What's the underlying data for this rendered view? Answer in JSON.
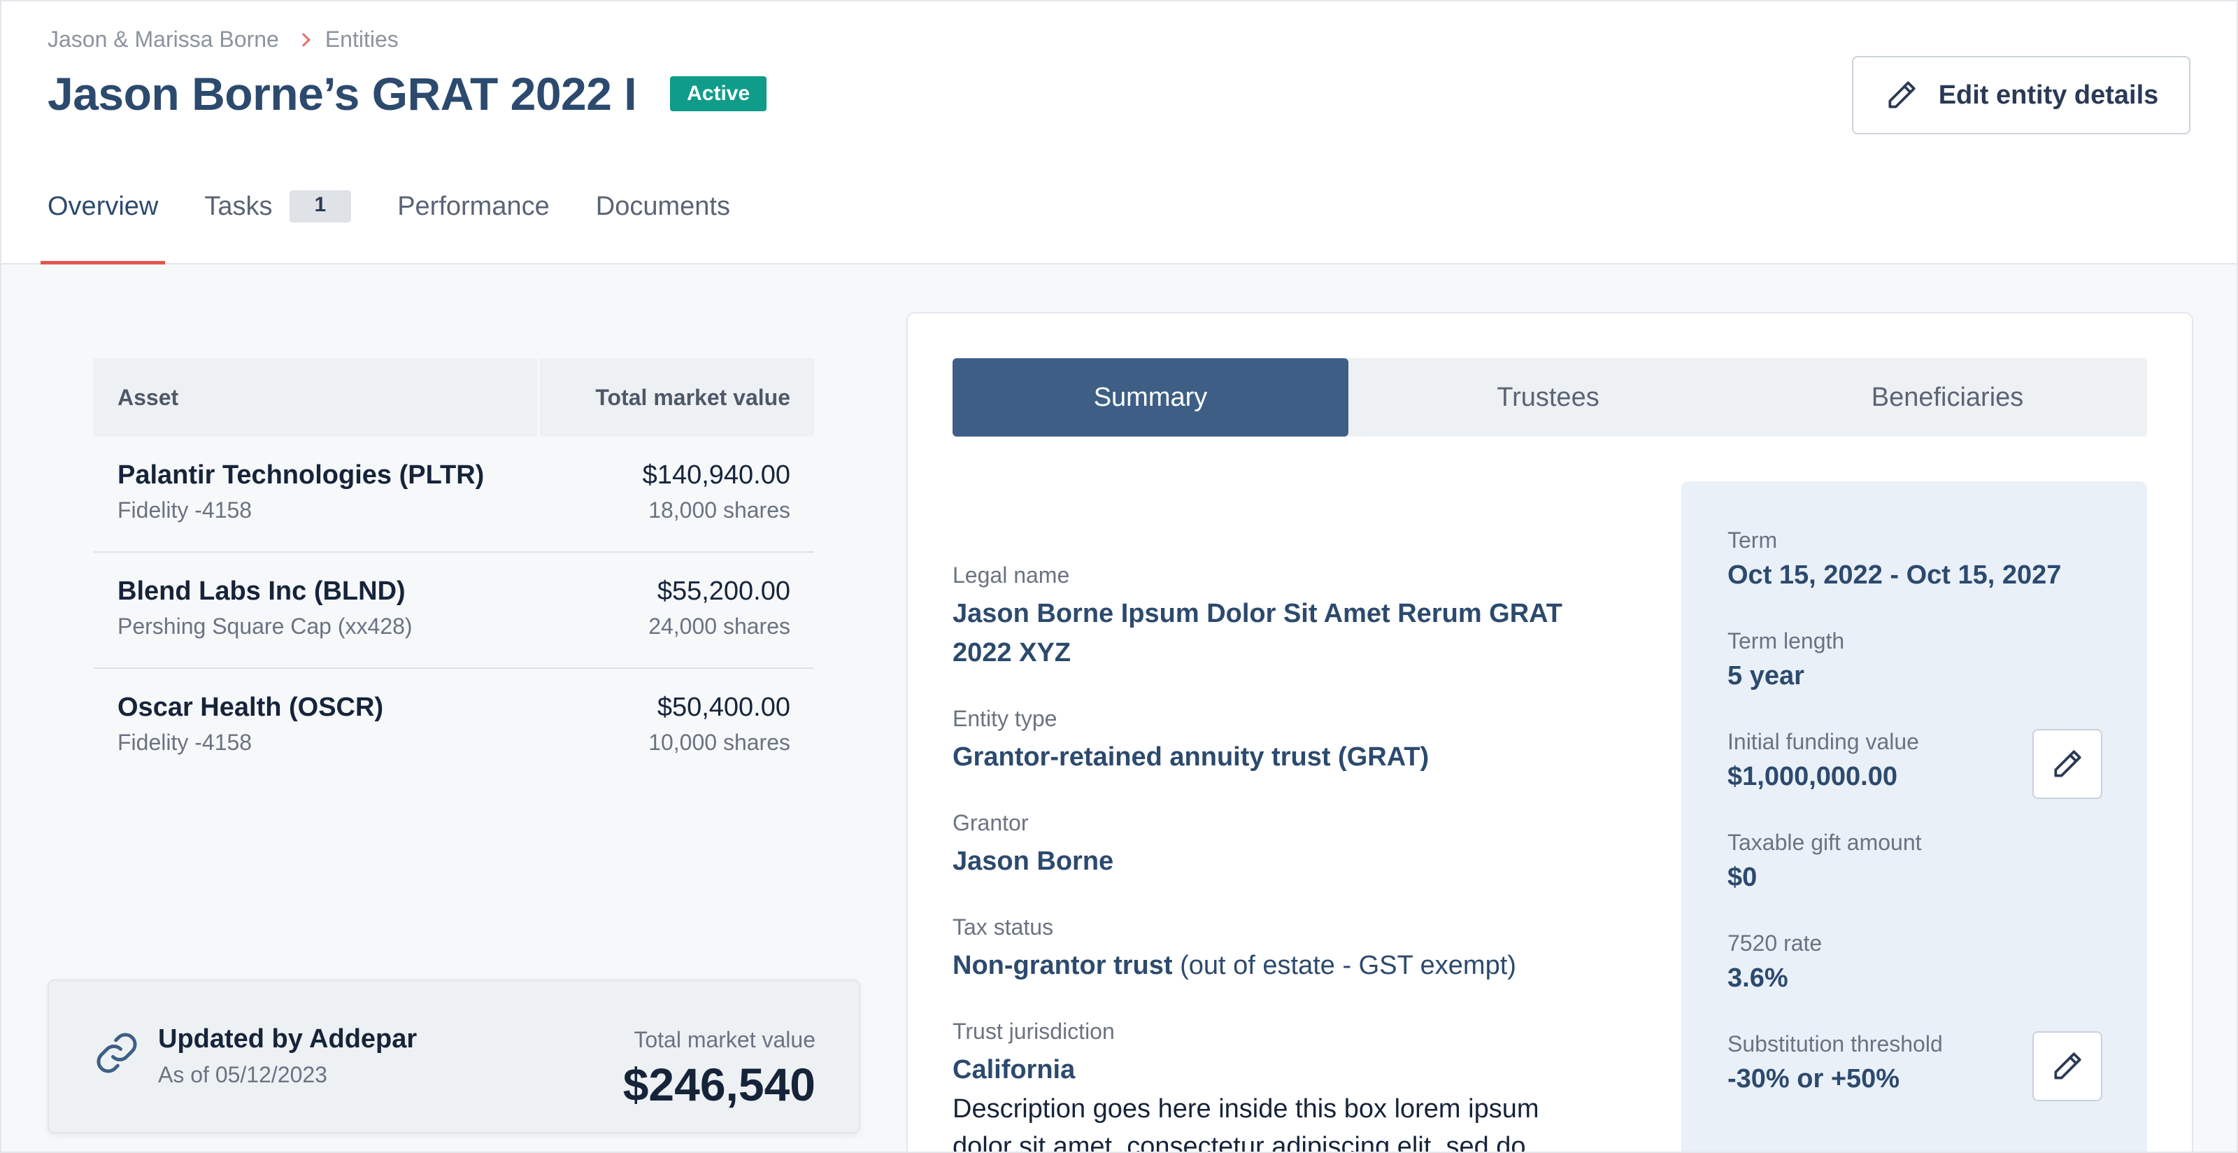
{
  "breadcrumb": {
    "parent": "Jason & Marissa Borne",
    "current": "Entities"
  },
  "header": {
    "title": "Jason Borne’s GRAT 2022 I",
    "status": "Active",
    "edit_label": "Edit entity details"
  },
  "tabs": [
    {
      "label": "Overview"
    },
    {
      "label": "Tasks",
      "count": "1"
    },
    {
      "label": "Performance"
    },
    {
      "label": "Documents"
    }
  ],
  "assets": {
    "col_asset": "Asset",
    "col_value": "Total market value",
    "rows": [
      {
        "name": "Palantir Technologies (PLTR)",
        "account": "Fidelity -4158",
        "value": "$140,940.00",
        "shares": "18,000 shares"
      },
      {
        "name": "Blend Labs Inc (BLND)",
        "account": "Pershing Square Cap (xx428)",
        "value": "$55,200.00",
        "shares": "24,000 shares"
      },
      {
        "name": "Oscar Health (OSCR)",
        "account": "Fidelity -4158",
        "value": "$50,400.00",
        "shares": "10,000 shares"
      }
    ]
  },
  "updated": {
    "title": "Updated by Addepar",
    "date": "As of 05/12/2023",
    "total_label": "Total market value",
    "total_value": "$246,540"
  },
  "segments": [
    "Summary",
    "Trustees",
    "Beneficiaries"
  ],
  "summary": {
    "legal_name_label": "Legal name",
    "legal_name": "Jason Borne Ipsum Dolor Sit Amet Rerum GRAT 2022 XYZ",
    "entity_type_label": "Entity type",
    "entity_type": "Grantor-retained annuity trust (GRAT)",
    "grantor_label": "Grantor",
    "grantor": "Jason Borne",
    "tax_status_label": "Tax status",
    "tax_status": "Non-grantor trust",
    "tax_status_note": " (out of estate - GST exempt)",
    "jurisdiction_label": "Trust jurisdiction",
    "jurisdiction": "California",
    "description": "Description goes here inside this box lorem ipsum dolor sit amet, consectetur adipiscing elit, sed do"
  },
  "terms": {
    "term_label": "Term",
    "term_value": "Oct 15, 2022 - Oct 15, 2027",
    "length_label": "Term length",
    "length_value": "5 year",
    "funding_label": "Initial funding value",
    "funding_value": "$1,000,000.00",
    "gift_label": "Taxable gift amount",
    "gift_value": "$0",
    "rate_label": "7520 rate",
    "rate_value": "3.6%",
    "threshold_label": "Substitution threshold",
    "threshold_value": "-30% or +50%"
  }
}
